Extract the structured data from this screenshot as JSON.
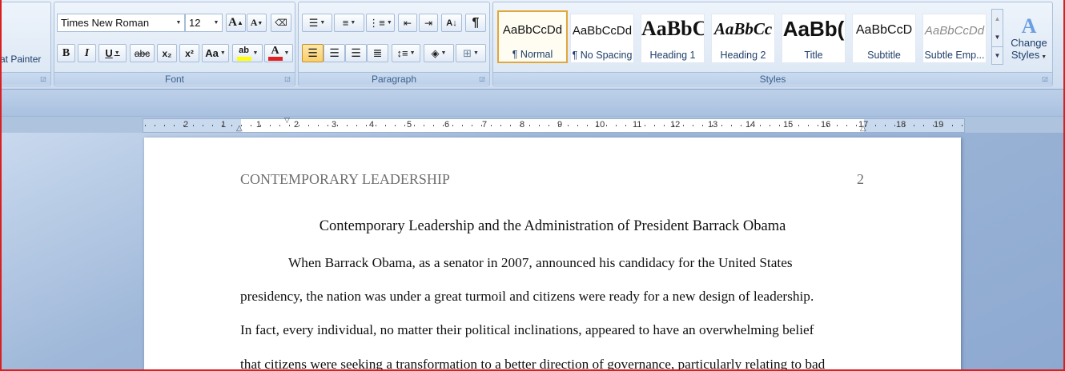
{
  "clipboard": {
    "format_painter": "at Painter"
  },
  "font": {
    "group_label": "Font",
    "family": "Times New Roman",
    "size": "12",
    "bold": "B",
    "italic": "I",
    "underline": "U",
    "strike": "abc",
    "subscript": "x₂",
    "superscript": "x²",
    "change_case": "Aa",
    "grow": "A",
    "shrink": "A",
    "highlight": "ab",
    "font_color": "A"
  },
  "paragraph": {
    "group_label": "Paragraph",
    "show_marks": "¶"
  },
  "styles": {
    "group_label": "Styles",
    "items": [
      {
        "sample": "AaBbCcDd",
        "name": "¶ Normal"
      },
      {
        "sample": "AaBbCcDd",
        "name": "¶ No Spacing"
      },
      {
        "sample": "AaBbC",
        "name": "Heading 1"
      },
      {
        "sample": "AaBbCc",
        "name": "Heading 2"
      },
      {
        "sample": "AaBb(",
        "name": "Title"
      },
      {
        "sample": "AaBbCcD",
        "name": "Subtitle"
      },
      {
        "sample": "AaBbCcDd",
        "name": "Subtle Emp..."
      }
    ],
    "change_styles_line1": "Change",
    "change_styles_line2": "Styles"
  },
  "ruler": {
    "labels": [
      "2",
      "1",
      "1",
      "2",
      "3",
      "4",
      "5",
      "6",
      "7",
      "8",
      "9",
      "10",
      "11",
      "12",
      "13",
      "14",
      "15",
      "16",
      "17",
      "18",
      "19"
    ]
  },
  "document": {
    "running_head": "CONTEMPORARY LEADERSHIP",
    "page_number": "2",
    "title": "Contemporary Leadership and the Administration of President Barrack Obama",
    "lines": [
      "When Barrack Obama, as a senator in 2007, announced his candidacy for the United States",
      "presidency, the nation was under a great turmoil and citizens were ready for a new design of leadership.",
      "In fact, every individual, no matter their political inclinations, appeared to have an overwhelming belief",
      "that citizens were seeking a transformation to a better direction of governance, particularly relating to bad"
    ]
  },
  "colors": {
    "highlight": "#ffff00",
    "font_color": "#e02020",
    "selected_style_border": "#e3a63a"
  }
}
